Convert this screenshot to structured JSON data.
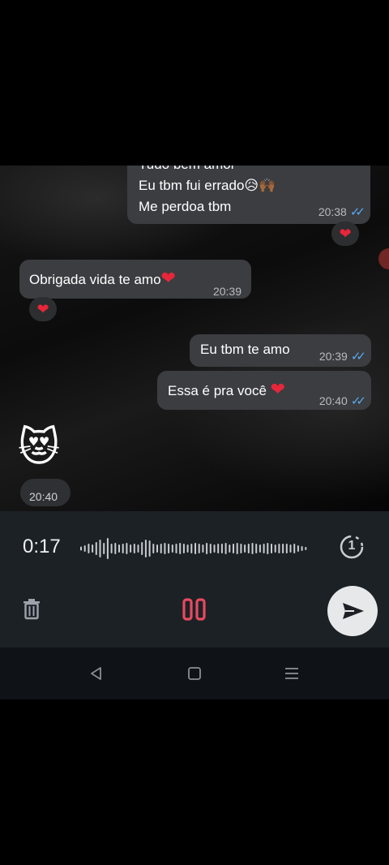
{
  "messages": {
    "m1_line0": "Tudo bem amor",
    "m1_line1": "Eu tbm fui errado😥🙌🏾",
    "m1_line2": "Me perdoa tbm",
    "m1_time": "20:38",
    "m1_reaction": "❤",
    "m2_text": "Obrigada vida te amo",
    "m2_emoji": "❤",
    "m2_time": "20:39",
    "m2_reaction": "❤",
    "m3_text": "Eu tbm te amo",
    "m3_time": "20:39",
    "m4_text": "Essa é pra você",
    "m4_emoji": "❤",
    "m4_time": "20:40",
    "m5_emoji": "😻",
    "m5_time": "20:40"
  },
  "recorder": {
    "duration": "0:17",
    "view_once_label": "1",
    "waveform_bars": [
      5,
      8,
      12,
      10,
      16,
      22,
      14,
      26,
      12,
      14,
      10,
      12,
      14,
      10,
      12,
      10,
      16,
      22,
      20,
      12,
      10,
      12,
      14,
      12,
      10,
      12,
      14,
      12,
      10,
      12,
      14,
      12,
      10,
      14,
      12,
      10,
      12,
      12,
      14,
      10,
      12,
      14,
      12,
      10,
      12,
      14,
      12,
      10,
      12,
      14,
      12,
      10,
      12,
      12,
      12,
      10,
      12,
      8,
      6,
      4
    ]
  },
  "colors": {
    "pause_accent": "#e84a5f",
    "tick_blue": "#5aa8f0",
    "bubble": "#3b3d40"
  }
}
